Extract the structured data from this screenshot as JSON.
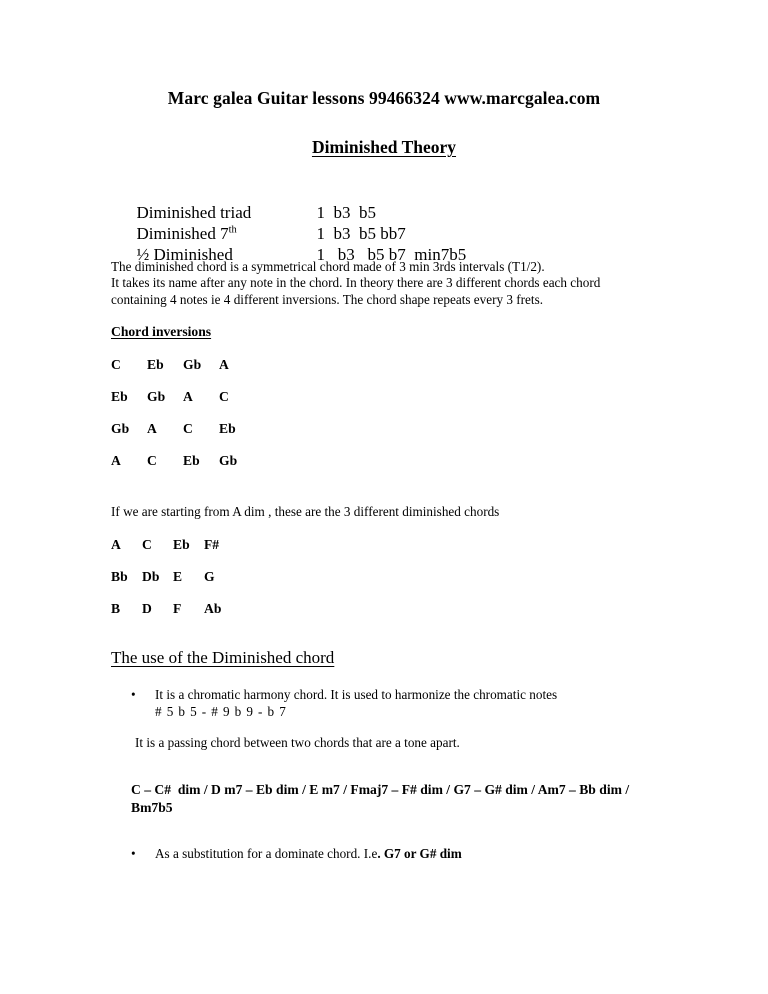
{
  "header": {
    "line": "Marc galea Guitar lessons 99466324 www.marcgalea.com",
    "title": "Diminished Theory"
  },
  "definitions": [
    {
      "label": "Diminished triad",
      "sup": "",
      "values": "1  b3  b5"
    },
    {
      "label": "Diminished 7",
      "sup": "th",
      "values": "1  b3  b5 bb7"
    },
    {
      "label": "½ Diminished",
      "sup": "",
      "values": "1   b3   b5 b7  min7b5"
    }
  ],
  "intro": {
    "line1": "The diminished chord is a symmetrical chord made of 3 min 3rds intervals (T1/2).",
    "line2": "It takes its name after any note in the chord. In theory there are 3 different chords each chord",
    "line3": "containing 4 notes ie 4 different inversions. The chord shape repeats every 3 frets."
  },
  "inversions": {
    "heading": "Chord inversions",
    "rows": [
      [
        "C",
        "Eb",
        "Gb",
        "A"
      ],
      [
        "Eb",
        "Gb",
        "A",
        "C"
      ],
      [
        "Gb",
        "A",
        "C",
        "Eb"
      ],
      [
        "A",
        "C",
        "Eb",
        "Gb"
      ]
    ]
  },
  "adim": {
    "intro": "If we are starting from A dim , these are the 3 different diminished chords",
    "rows": [
      [
        "A",
        "C",
        "Eb",
        "F#"
      ],
      [
        "Bb",
        "Db",
        "E",
        "G"
      ],
      [
        "B",
        "D",
        "F",
        "Ab"
      ]
    ]
  },
  "use_section": {
    "heading": "The use of the Diminished chord",
    "bullet1": {
      "marker": "•",
      "text": "It is a chromatic harmony chord. It is used to harmonize the chromatic notes",
      "subtext": "# 5 b 5 - # 9 b 9 - b 7"
    },
    "passing_note": "It is a passing chord between two chords that are a tone apart.",
    "progression_line1": "C – C#  dim / D m7 – Eb dim / E m7 / Fmaj7 – F# dim / G7 – G# dim / Am7 – Bb dim /",
    "progression_line2": "Bm7b5",
    "bullet2": {
      "marker": "•",
      "text_plain": "As a substitution for a dominate chord. I.e",
      "text_bold": ". G7 or G# dim"
    }
  }
}
